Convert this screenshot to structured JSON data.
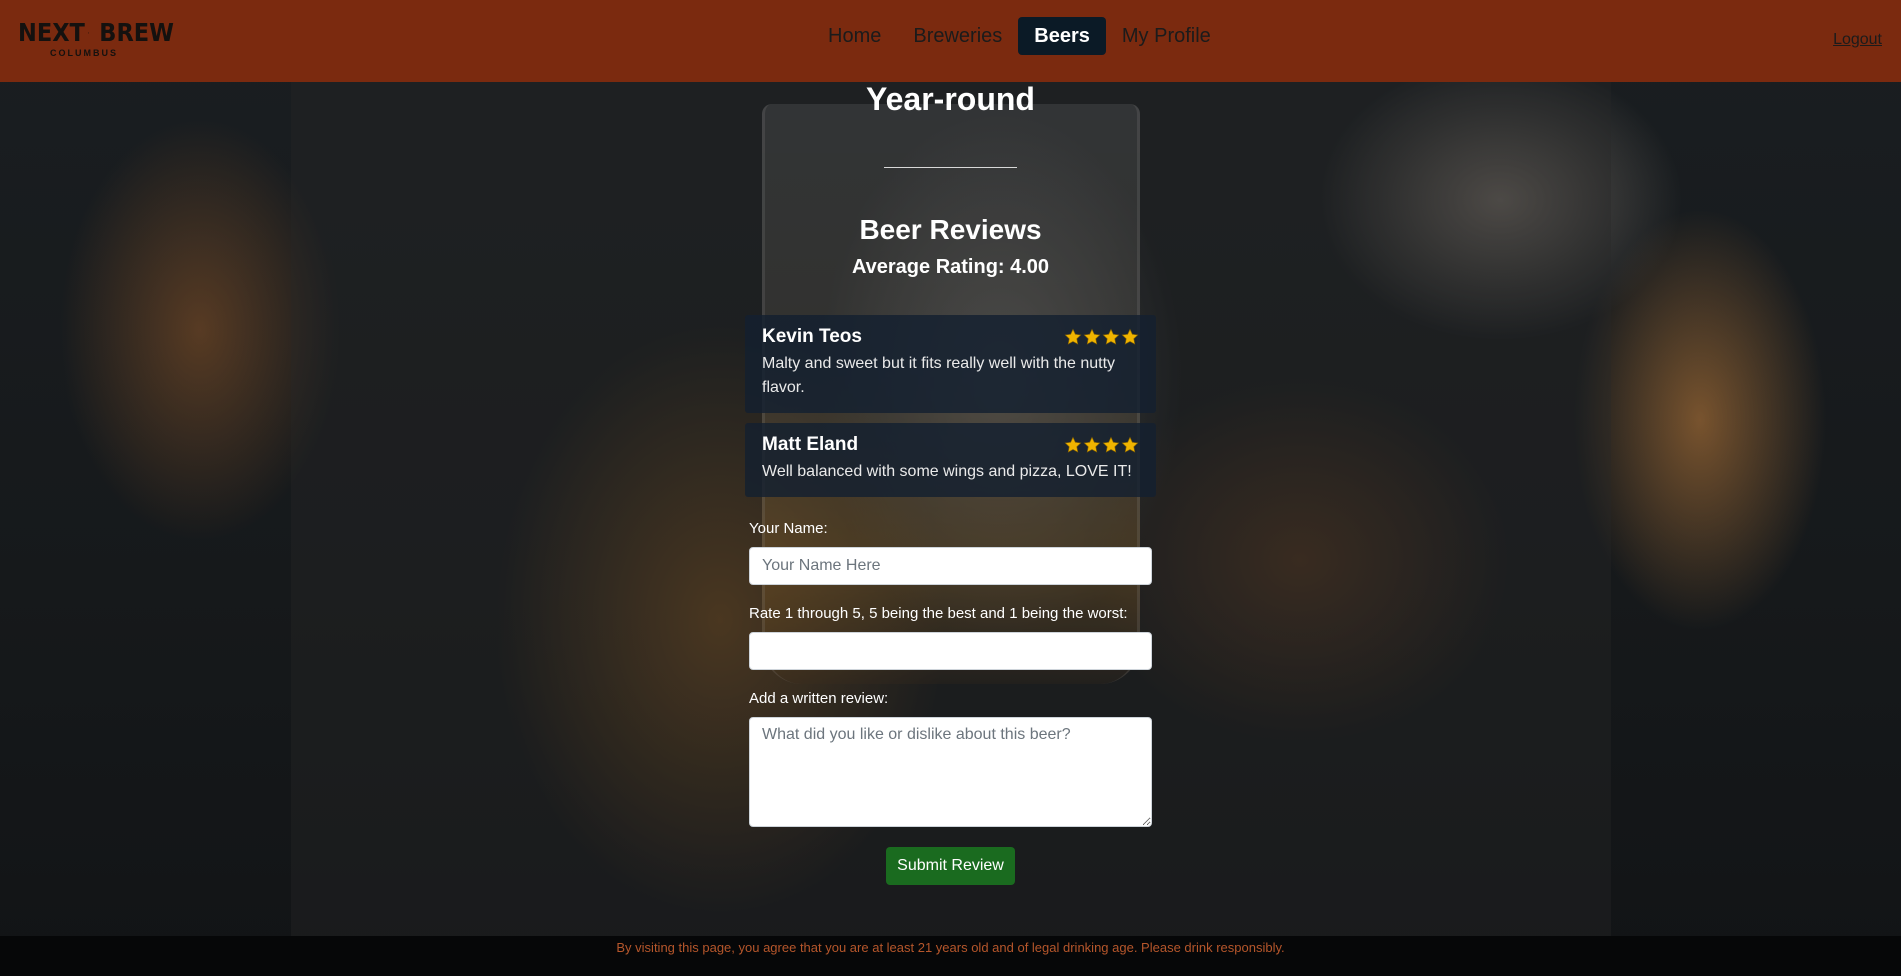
{
  "brand": {
    "logo_left": "NEXT",
    "logo_right": "BREW",
    "logo_sub": "COLUMBUS"
  },
  "nav": {
    "items": [
      {
        "label": "Home",
        "active": false
      },
      {
        "label": "Breweries",
        "active": false
      },
      {
        "label": "Beers",
        "active": true
      },
      {
        "label": "My Profile",
        "active": false
      }
    ],
    "logout": "Logout"
  },
  "beer": {
    "availability": "Year-round"
  },
  "reviews": {
    "title": "Beer Reviews",
    "average": "Average Rating: 4.00",
    "items": [
      {
        "name": "Kevin Teos",
        "rating": 4,
        "text": "Malty and sweet but it fits really well with the nutty flavor."
      },
      {
        "name": "Matt Eland",
        "rating": 4,
        "text": "Well balanced with some wings and pizza, LOVE IT!"
      }
    ]
  },
  "form": {
    "name_label": "Your Name:",
    "name_placeholder": "Your Name Here",
    "rating_label": "Rate 1 through 5, 5 being the best and 1 being the worst:",
    "review_label": "Add a written review:",
    "review_placeholder": "What did you like or dislike about this beer?",
    "submit_label": "Submit Review"
  },
  "footer": {
    "text": "By visiting this page, you agree that you are at least 21 years old and of legal drinking age. Please drink responsibly."
  },
  "colors": {
    "navbar": "#7b2a0f",
    "nav_active": "#0b1a26",
    "star": "#f0b400",
    "submit": "#1a6b1f",
    "footer_text": "#b5562b"
  }
}
